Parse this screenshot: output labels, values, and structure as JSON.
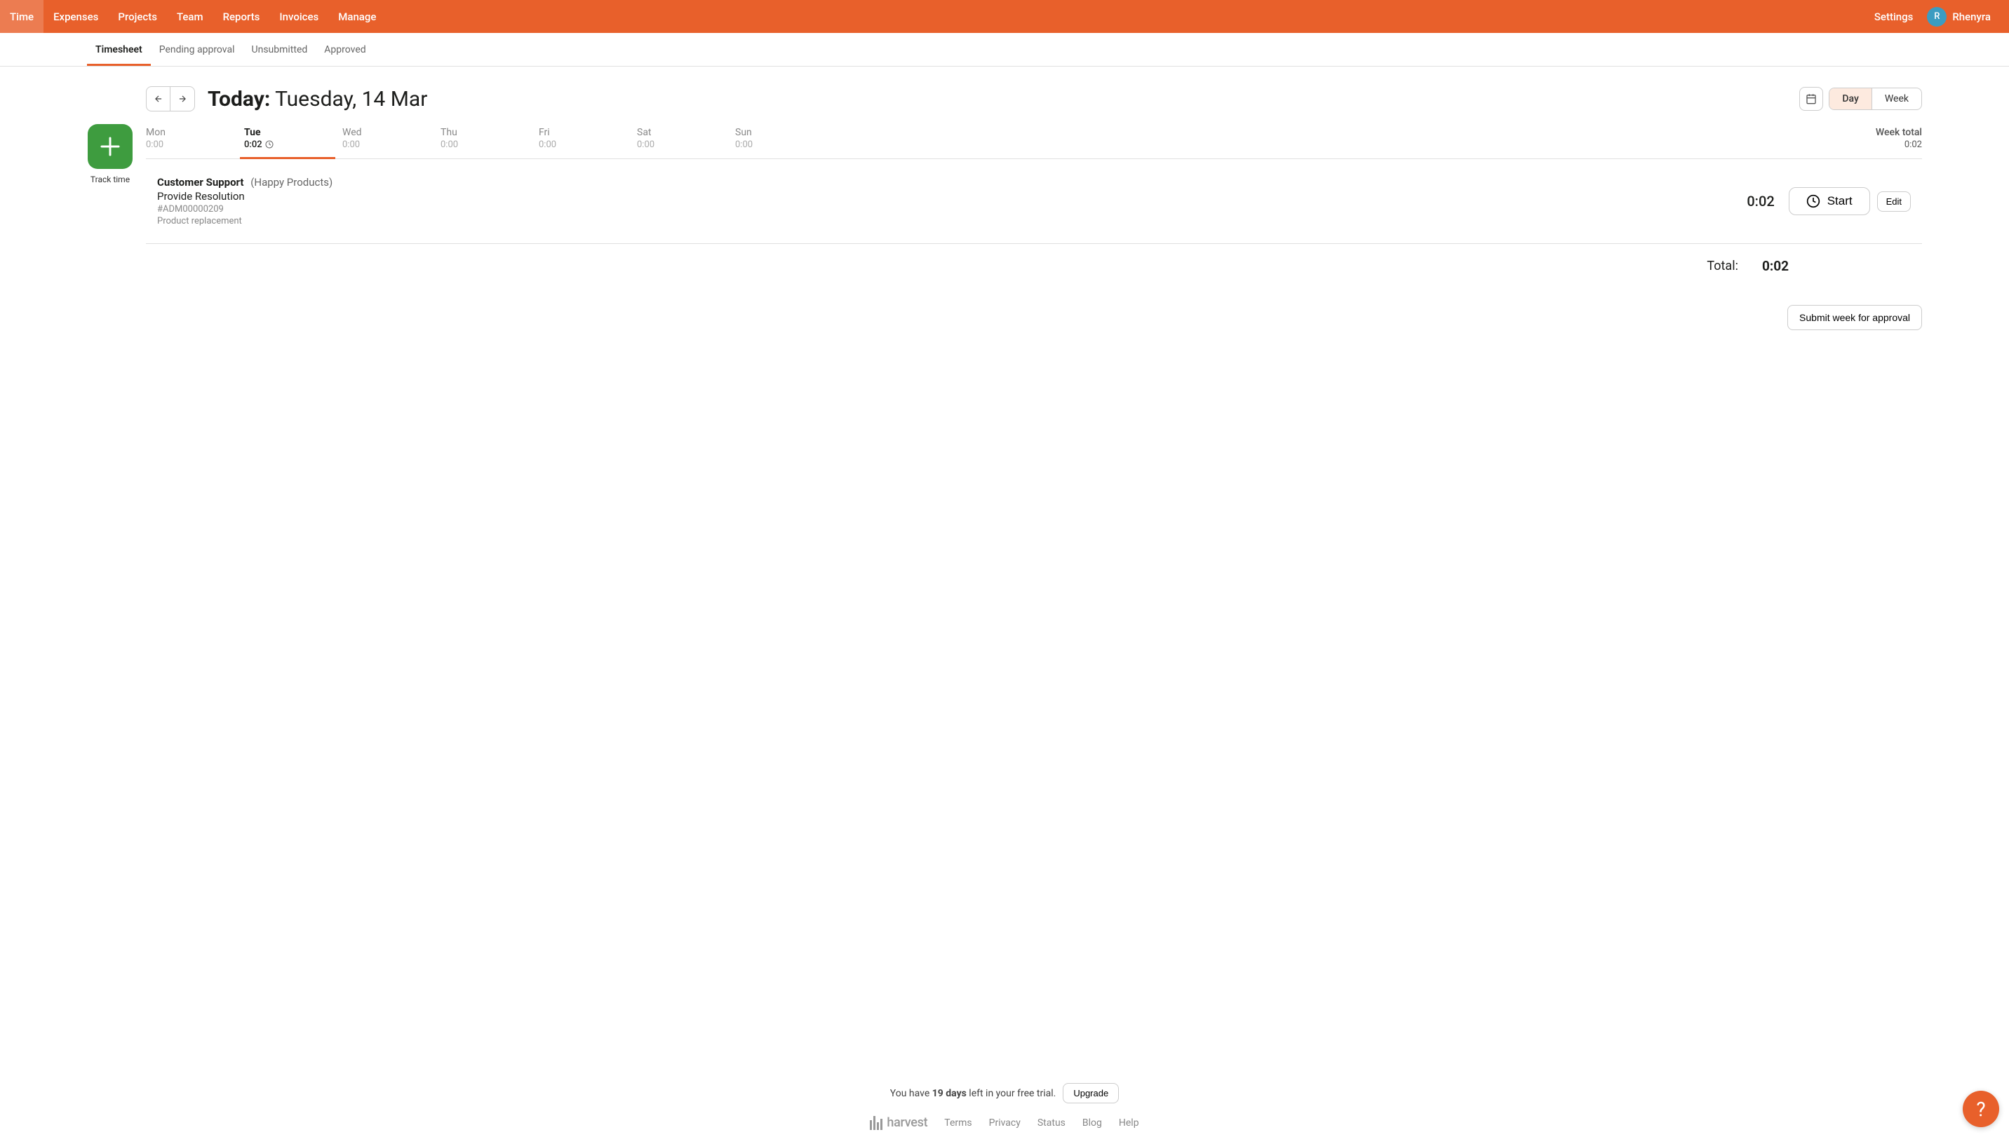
{
  "top_nav": {
    "left": [
      "Time",
      "Expenses",
      "Projects",
      "Team",
      "Reports",
      "Invoices",
      "Manage"
    ],
    "active_index": 0,
    "settings": "Settings",
    "user_initial": "R",
    "user_name": "Rhenyra"
  },
  "sub_nav": {
    "items": [
      "Timesheet",
      "Pending approval",
      "Unsubmitted",
      "Approved"
    ],
    "active_index": 0
  },
  "page_title": {
    "prefix": "Today:",
    "rest": " Tuesday, 14 Mar"
  },
  "view_toggle": {
    "day": "Day",
    "week": "Week",
    "active": "day"
  },
  "days": [
    {
      "name": "Mon",
      "time": "0:00"
    },
    {
      "name": "Tue",
      "time": "0:02",
      "running": true
    },
    {
      "name": "Wed",
      "time": "0:00"
    },
    {
      "name": "Thu",
      "time": "0:00"
    },
    {
      "name": "Fri",
      "time": "0:00"
    },
    {
      "name": "Sat",
      "time": "0:00"
    },
    {
      "name": "Sun",
      "time": "0:00"
    }
  ],
  "active_day_index": 1,
  "week_total": {
    "label": "Week total",
    "time": "0:02"
  },
  "track_time_label": "Track time",
  "entry": {
    "project": "Customer Support",
    "client": "(Happy Products)",
    "task": "Provide Resolution",
    "ref": "#ADM00000209",
    "note": "Product replacement",
    "time": "0:02",
    "start_label": "Start",
    "edit_label": "Edit"
  },
  "total": {
    "label": "Total:",
    "value": "0:02"
  },
  "submit_label": "Submit week for approval",
  "trial": {
    "prefix": "You have ",
    "days": "19 days",
    "suffix": " left in your free trial.",
    "upgrade": "Upgrade"
  },
  "footer": {
    "logo": "harvest",
    "links": [
      "Terms",
      "Privacy",
      "Status",
      "Blog",
      "Help"
    ]
  },
  "help_bubble": "?"
}
